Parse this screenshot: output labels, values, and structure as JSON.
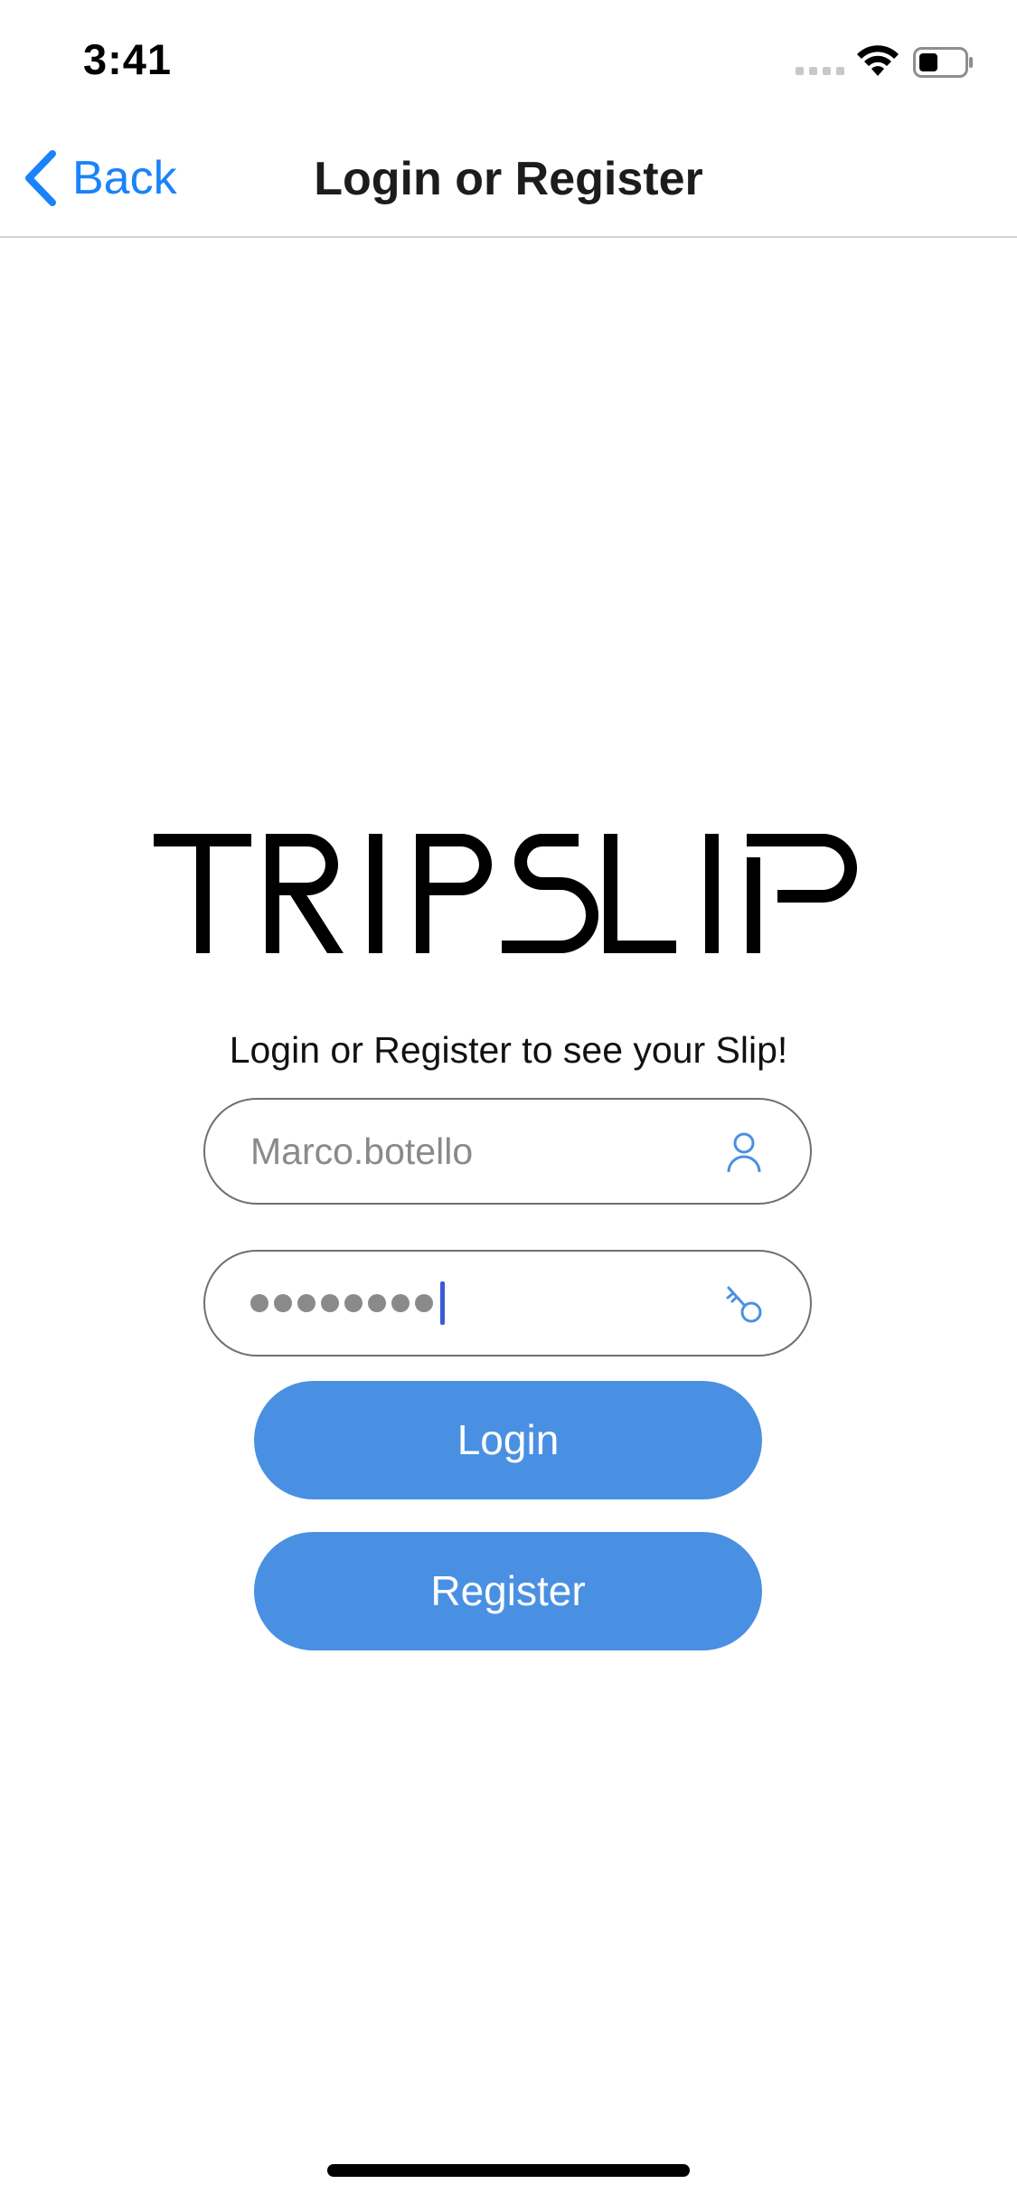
{
  "status_bar": {
    "time": "3:41"
  },
  "nav": {
    "back_label": "Back",
    "title": "Login or Register"
  },
  "logo": {
    "text": "TRIPSLIP"
  },
  "subtitle": "Login or Register to see your Slip!",
  "username_field": {
    "value": "Marco.botello",
    "icon": "person-icon"
  },
  "password_field": {
    "masked_length": 8,
    "icon": "key-icon"
  },
  "buttons": {
    "login": "Login",
    "register": "Register"
  },
  "colors": {
    "accent": "#4a90e2",
    "link": "#1a82fb"
  }
}
